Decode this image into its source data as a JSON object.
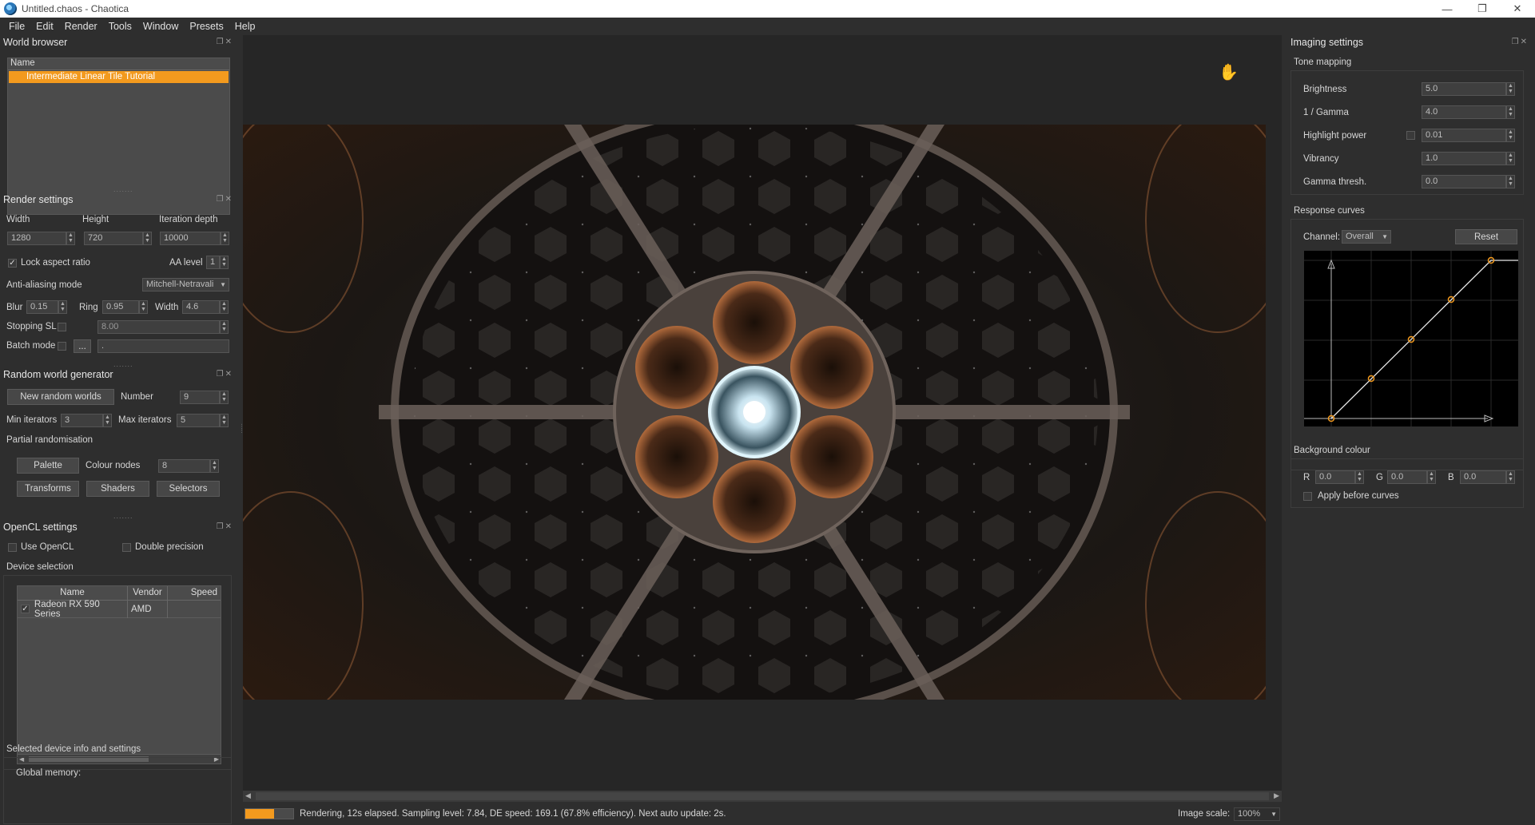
{
  "window": {
    "title": "Untitled.chaos - Chaotica",
    "controls": [
      "—",
      "❐",
      "✕"
    ]
  },
  "menu": [
    "File",
    "Edit",
    "Render",
    "Tools",
    "Window",
    "Presets",
    "Help"
  ],
  "world_browser": {
    "title": "World browser",
    "column_header": "Name",
    "items": [
      "Intermediate Linear Tile Tutorial"
    ]
  },
  "render_settings": {
    "title": "Render settings",
    "width_label": "Width",
    "width_value": "1280",
    "height_label": "Height",
    "height_value": "720",
    "iter_label": "Iteration depth",
    "iter_value": "10000",
    "lock_aspect_label": "Lock aspect ratio",
    "lock_aspect_checked": true,
    "aa_level_label": "AA level",
    "aa_level_value": "1",
    "aa_mode_label": "Anti-aliasing mode",
    "aa_mode_value": "Mitchell-Netravali",
    "blur_label": "Blur",
    "blur_value": "0.15",
    "ring_label": "Ring",
    "ring_value": "0.95",
    "width2_label": "Width",
    "width2_value": "4.6",
    "stopping_label": "Stopping SL",
    "stopping_value": "8.00",
    "batch_label": "Batch mode",
    "batch_browse": "...",
    "batch_value": "."
  },
  "random_world": {
    "title": "Random world generator",
    "new_button": "New random worlds",
    "number_label": "Number",
    "number_value": "9",
    "min_iter_label": "Min iterators",
    "min_iter_value": "3",
    "max_iter_label": "Max iterators",
    "max_iter_value": "5",
    "partial_label": "Partial randomisation",
    "palette_button": "Palette",
    "colour_nodes_label": "Colour nodes",
    "colour_nodes_value": "8",
    "transforms_button": "Transforms",
    "shaders_button": "Shaders",
    "selectors_button": "Selectors"
  },
  "opencl": {
    "title": "OpenCL settings",
    "use_opencl_label": "Use OpenCL",
    "double_precision_label": "Double precision",
    "device_selection_label": "Device selection",
    "columns": [
      "Name",
      "Vendor",
      "Speed"
    ],
    "devices": [
      {
        "name": "Radeon RX 590 Series",
        "vendor": "AMD",
        "speed": "",
        "checked": true
      }
    ],
    "selected_info_label": "Selected device info and settings",
    "global_memory_label": "Global memory:"
  },
  "status": {
    "progress": 0.6,
    "text": "Rendering, 12s elapsed. Sampling level: 7.84, DE speed: 169.1 (67.8% efficiency). Next auto update: 2s.",
    "image_scale_label": "Image scale:",
    "image_scale_value": "100%"
  },
  "imaging": {
    "title": "Imaging settings",
    "tone_mapping_label": "Tone mapping",
    "brightness_label": "Brightness",
    "brightness_value": "5.0",
    "gamma_label": "1 / Gamma",
    "gamma_value": "4.0",
    "highlight_label": "Highlight power",
    "highlight_value": "0.01",
    "vibrancy_label": "Vibrancy",
    "vibrancy_value": "1.0",
    "gamma_thresh_label": "Gamma thresh.",
    "gamma_thresh_value": "0.0",
    "response_curves_label": "Response curves",
    "channel_label": "Channel:",
    "channel_value": "Overall",
    "reset_button": "Reset",
    "bg_colour_label": "Background colour",
    "r_label": "R",
    "r_value": "0.0",
    "g_label": "G",
    "g_value": "0.0",
    "b_label": "B",
    "b_value": "0.0",
    "apply_before_label": "Apply before curves"
  },
  "colors": {
    "accent": "#f39a1e",
    "panel_bg": "#2e2e2e",
    "field_bg": "#3f3f3f",
    "viewport_bg": "#262626"
  }
}
